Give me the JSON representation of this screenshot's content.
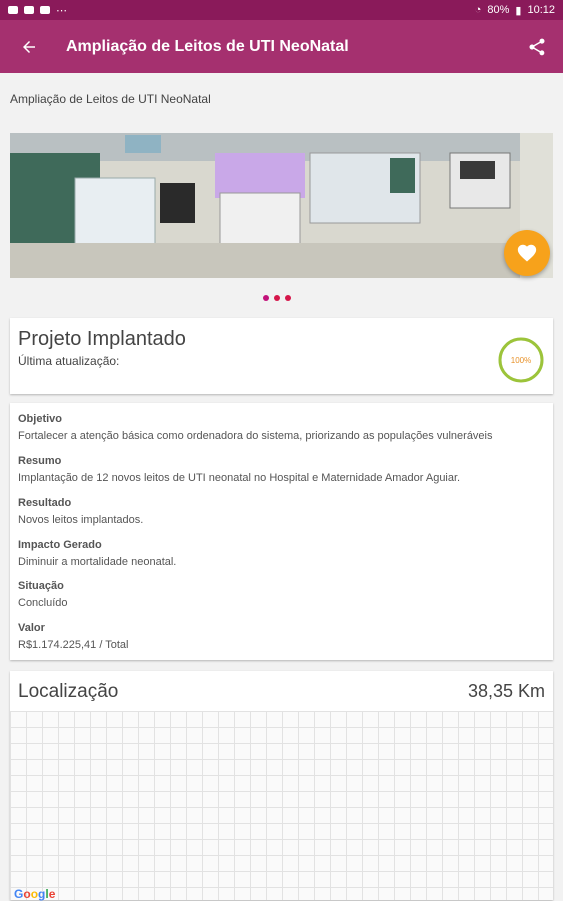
{
  "status_bar": {
    "battery": "80%",
    "time": "10:12"
  },
  "app_bar": {
    "title": "Ampliação de Leitos de UTI NeoNatal"
  },
  "subtitle": "Ampliação de Leitos de UTI NeoNatal",
  "status_card": {
    "title": "Projeto Implantado",
    "updated_label": "Última atualização:",
    "progress_label": "100%",
    "progress": 1.0
  },
  "details": {
    "objetivo": {
      "label": "Objetivo",
      "value": "Fortalecer a atenção básica como ordenadora do sistema, priorizando as populações vulneráveis"
    },
    "resumo": {
      "label": "Resumo",
      "value": "Implantação de 12 novos leitos de UTI neonatal no Hospital e Maternidade Amador Aguiar."
    },
    "resultado": {
      "label": "Resultado",
      "value": "Novos leitos implantados."
    },
    "impacto": {
      "label": "Impacto Gerado",
      "value": "Diminuir a mortalidade neonatal."
    },
    "situacao": {
      "label": "Situação",
      "value": "Concluído"
    },
    "valor": {
      "label": "Valor",
      "value": "R$1.174.225,41 / Total"
    }
  },
  "location": {
    "title": "Localização",
    "distance": "38,35 Km",
    "map_logo": "Google"
  },
  "colors": {
    "app_bar": "#a5306f",
    "status_bar": "#8a1a5a",
    "fav": "#f7a21b",
    "accent": "#c2117a"
  },
  "icons": {
    "back": "arrow-back-icon",
    "share": "share-icon",
    "favorite": "heart-icon"
  }
}
